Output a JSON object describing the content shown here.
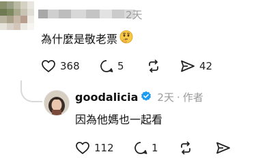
{
  "comment": {
    "time": "2天",
    "text": "為什麼是敬老票",
    "emoji_icon": "thinking-face-emoji",
    "actions": {
      "likes": "368",
      "replies": "5",
      "shares": "42"
    }
  },
  "reply": {
    "username": "goodalicia",
    "time": "2天",
    "separator": "·",
    "author_tag": "作者",
    "text": "因為他媽也一起看",
    "actions": {
      "likes": "112",
      "replies": "1"
    }
  },
  "colors": {
    "muted": "#9a9a9a",
    "verified_blue": "#1d9bf0",
    "thread_line": "#d9d9d9"
  }
}
